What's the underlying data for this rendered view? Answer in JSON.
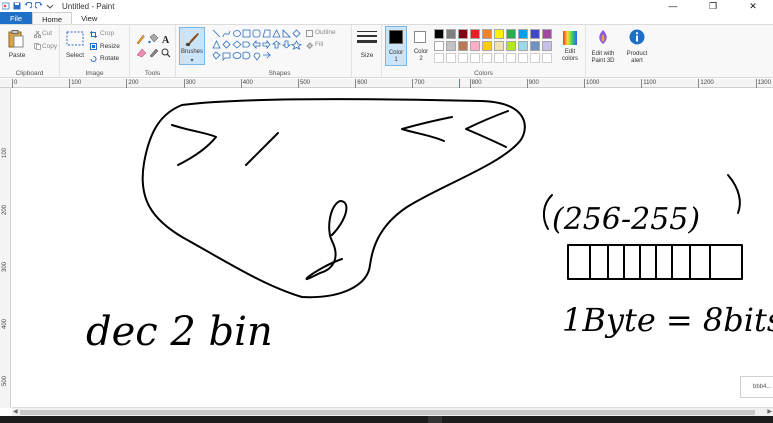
{
  "window": {
    "title": "Untitled - Paint",
    "minimize_glyph": "—",
    "maximize_glyph": "❐",
    "close_glyph": "✕"
  },
  "tabs": [
    "File",
    "Home",
    "View"
  ],
  "ribbon": {
    "clipboard": {
      "label": "Clipboard",
      "paste": "Paste",
      "cut": "Cut",
      "copy": "Copy"
    },
    "image": {
      "label": "Image",
      "select": "Select",
      "crop": "Crop",
      "resize": "Resize",
      "rotate": "Rotate"
    },
    "tools": {
      "label": "Tools",
      "brushes": "Brushes"
    },
    "shapes": {
      "label": "Shapes",
      "outline": "Outline",
      "fill": "Fill"
    },
    "size": {
      "label": "Size"
    },
    "colors": {
      "label": "Colors",
      "color1_line1": "Color",
      "color1_line2": "1",
      "color2_line1": "Color",
      "color2_line2": "2",
      "edit_colors_line1": "Edit",
      "edit_colors_line2": "colors",
      "row1": [
        "#000000",
        "#7f7f7f",
        "#880015",
        "#ed1c24",
        "#ff7f27",
        "#fff200",
        "#22b14c",
        "#00a2e8",
        "#3f48cc",
        "#a349a4"
      ],
      "row2": [
        "#ffffff",
        "#c3c3c3",
        "#b97a57",
        "#ffaec9",
        "#ffc90e",
        "#efe4b0",
        "#b5e61d",
        "#99d9ea",
        "#7092be",
        "#c8bfe7"
      ],
      "row3": [
        "#ffffff",
        "#ffffff",
        "#ffffff",
        "#ffffff",
        "#ffffff",
        "#ffffff",
        "#ffffff",
        "#ffffff",
        "#ffffff",
        "#ffffff"
      ]
    },
    "paint3d_line1": "Edit with",
    "paint3d_line2": "Paint 3D",
    "alert_line1": "Product",
    "alert_line2": "alert"
  },
  "ruler": {
    "marks": [
      "0",
      "100",
      "200",
      "300",
      "400",
      "500",
      "600",
      "700",
      "800",
      "900",
      "1000",
      "1100",
      "1200",
      "1300"
    ],
    "vmarks": [
      "100",
      "200",
      "300",
      "400",
      "500"
    ]
  },
  "canvas_text": {
    "dec2bin": "dec 2 bin",
    "byte_eq": "1Byte = 8bits",
    "paren": "(256-255)"
  },
  "toast": {
    "text": "bbb4..."
  }
}
